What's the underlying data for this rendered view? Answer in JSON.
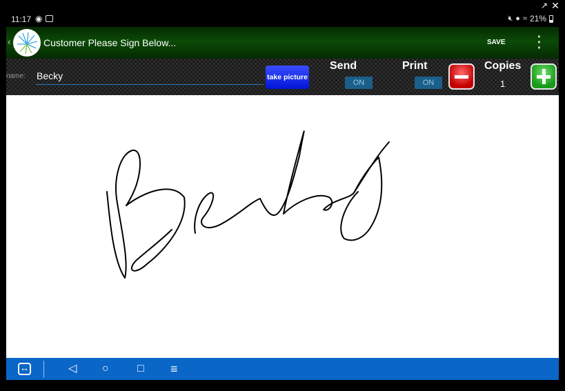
{
  "status_bar": {
    "time": "11:17",
    "battery": "21%"
  },
  "app_bar": {
    "title": "Customer Please Sign Below...",
    "save_label": "SAVE"
  },
  "form": {
    "name_label": "name:",
    "name_value": "Becky",
    "take_picture_label": "take picture",
    "send_label": "Send",
    "send_toggle": "ON",
    "print_label": "Print",
    "print_toggle": "ON",
    "copies_label": "Copies",
    "copies_value": "1"
  },
  "colors": {
    "app_bar": "#0b4a06",
    "nav_bar": "#0a66c7",
    "take_picture": "#0016d8",
    "minus": "#c40000",
    "plus": "#199a19",
    "toggle": "#1b5f8a"
  },
  "icons": {
    "window": [
      "popout-icon",
      "close-icon"
    ],
    "status": [
      "eye-icon",
      "teamviewer-icon",
      "mute-icon",
      "location-icon",
      "wifi-icon",
      "battery-icon"
    ],
    "navigation": [
      "teamviewer-icon",
      "back-icon",
      "home-icon",
      "recents-icon",
      "menu-icon"
    ]
  }
}
